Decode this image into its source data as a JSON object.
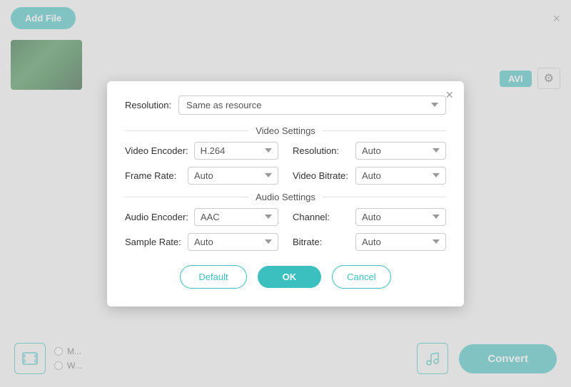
{
  "app": {
    "add_file_label": "Add File",
    "close_label": "×"
  },
  "format_badge": "AVI",
  "convert_btn_label": "Convert",
  "bottom": {
    "option1": "M...",
    "option2": "W..."
  },
  "modal": {
    "close_label": "×",
    "resolution_label": "Resolution:",
    "resolution_value": "Same as resource",
    "video_settings_title": "Video Settings",
    "audio_settings_title": "Audio Settings",
    "video_encoder_label": "Video Encoder:",
    "video_encoder_value": "H.264",
    "resolution_right_label": "Resolution:",
    "resolution_right_value": "Auto",
    "frame_rate_label": "Frame Rate:",
    "frame_rate_value": "Auto",
    "video_bitrate_label": "Video Bitrate:",
    "video_bitrate_value": "Auto",
    "audio_encoder_label": "Audio Encoder:",
    "audio_encoder_value": "AAC",
    "channel_label": "Channel:",
    "channel_value": "Auto",
    "sample_rate_label": "Sample Rate:",
    "sample_rate_value": "Auto",
    "bitrate_label": "Bitrate:",
    "bitrate_value": "Auto",
    "default_btn_label": "Default",
    "ok_btn_label": "OK",
    "cancel_btn_label": "Cancel"
  }
}
